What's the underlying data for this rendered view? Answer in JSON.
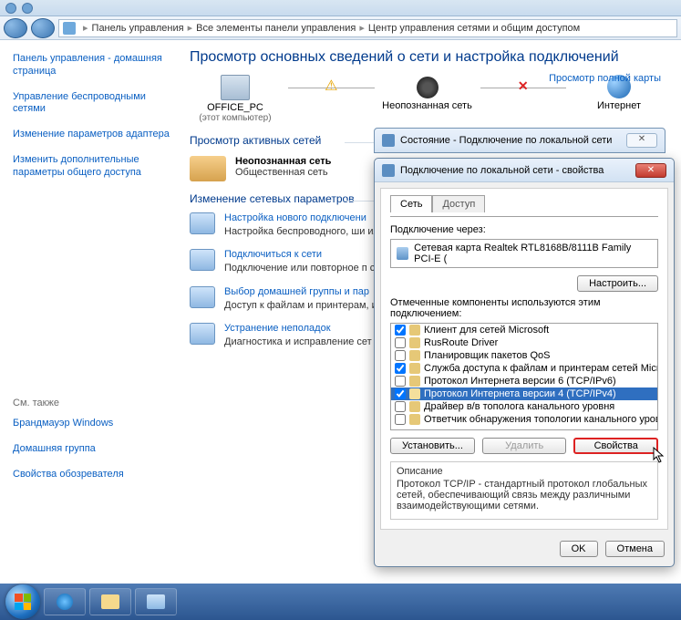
{
  "breadcrumb": {
    "p1": "Панель управления",
    "p2": "Все элементы панели управления",
    "p3": "Центр управления сетями и общим доступом"
  },
  "sidebar": {
    "links": [
      "Панель управления - домашняя страница",
      "Управление беспроводными сетями",
      "Изменение параметров адаптера",
      "Изменить дополнительные параметры общего доступа"
    ],
    "seealso_hdr": "См. также",
    "seealso": [
      "Брандмауэр Windows",
      "Домашняя группа",
      "Свойства обозревателя"
    ]
  },
  "main": {
    "heading": "Просмотр основных сведений о сети и настройка подключений",
    "maplink": "Просмотр полной карты",
    "nodes": {
      "pc": {
        "name": "OFFICE_PC",
        "sub": "(этот компьютер)"
      },
      "net": {
        "name": "Неопознанная сеть"
      },
      "inet": {
        "name": "Интернет"
      }
    },
    "sec_active": "Просмотр активных сетей",
    "net_name": "Неопознанная сеть",
    "net_type": "Общественная сеть",
    "sec_change": "Изменение сетевых параметров",
    "tasks": [
      {
        "link": "Настройка нового подключени",
        "desc": "Настройка беспроводного, ши\nили же настройка маршрутиза"
      },
      {
        "link": "Подключиться к сети",
        "desc": "Подключение или повторное п\nсетевому соединению или под"
      },
      {
        "link": "Выбор домашней группы и пар",
        "desc": "Доступ к файлам и принтерам,\nизменение параметров общего"
      },
      {
        "link": "Устранение неполадок",
        "desc": "Диагностика и исправление сет"
      }
    ]
  },
  "dlg_status": {
    "title": "Состояние - Подключение по локальной сети"
  },
  "dlg_prop": {
    "title": "Подключение по локальной сети - свойства",
    "tab_net": "Сеть",
    "tab_access": "Доступ",
    "conn_via": "Подключение через:",
    "adapter": "Сетевая карта Realtek RTL8168B/8111B Family PCI-E (",
    "btn_config": "Настроить...",
    "comp_label": "Отмеченные компоненты используются этим подключением:",
    "components": [
      {
        "c": true,
        "t": "Клиент для сетей Microsoft"
      },
      {
        "c": false,
        "t": "RusRoute Driver"
      },
      {
        "c": false,
        "t": "Планировщик пакетов QoS"
      },
      {
        "c": true,
        "t": "Служба доступа к файлам и принтерам сетей Micro..."
      },
      {
        "c": false,
        "t": "Протокол Интернета версии 6 (TCP/IPv6)"
      },
      {
        "c": true,
        "t": "Протокол Интернета версии 4 (TCP/IPv4)",
        "sel": true
      },
      {
        "c": false,
        "t": "Драйвер в/в тополога канального уровня"
      },
      {
        "c": false,
        "t": "Ответчик обнаружения топологии канального уровня"
      }
    ],
    "btn_install": "Установить...",
    "btn_remove": "Удалить",
    "btn_props": "Свойства",
    "desc_hdr": "Описание",
    "desc_body": "Протокол TCP/IP - стандартный протокол глобальных сетей, обеспечивающий связь между различными взаимодействующими сетями.",
    "btn_ok": "OK",
    "btn_cancel": "Отмена"
  }
}
